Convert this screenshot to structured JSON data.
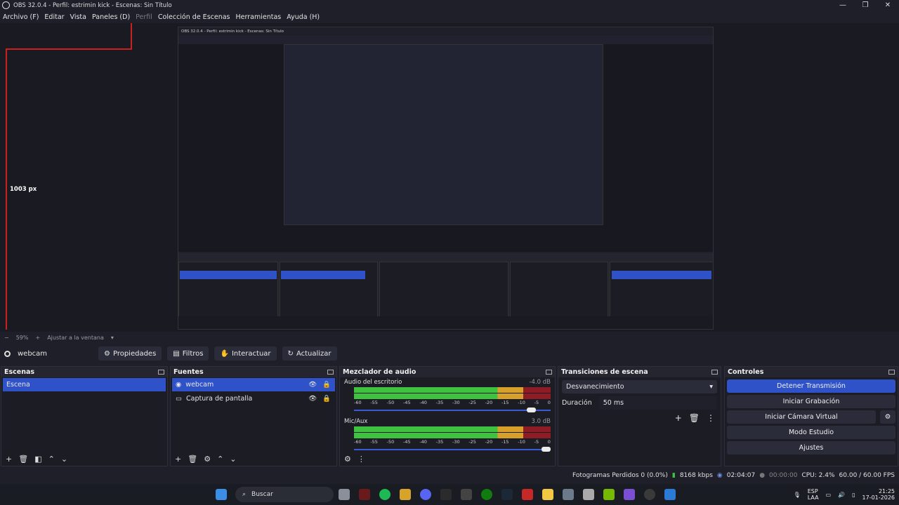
{
  "window": {
    "title": "OBS 32.0.4 - Perfil: estrimin kick - Escenas: Sin Título",
    "controls": [
      "—",
      "❐",
      "✕"
    ]
  },
  "menu": {
    "items": [
      {
        "label": "Archivo (F)",
        "enabled": true
      },
      {
        "label": "Editar",
        "enabled": true
      },
      {
        "label": "Vista",
        "enabled": true
      },
      {
        "label": "Paneles (D)",
        "enabled": true
      },
      {
        "label": "Perfil",
        "enabled": false
      },
      {
        "label": "Colección de Escenas",
        "enabled": true
      },
      {
        "label": "Herramientas",
        "enabled": true
      },
      {
        "label": "Ayuda (H)",
        "enabled": true
      }
    ]
  },
  "preview": {
    "measure_label": "1003 px",
    "nested_title": "OBS 32.0.4 - Perfil: estrimin kick - Escenas: Sin Título"
  },
  "zoom": {
    "minus": "−",
    "value": "59%",
    "plus": "+",
    "fit_label": "Ajustar a la ventana"
  },
  "source_toolbar": {
    "source_name": "webcam",
    "buttons": {
      "properties": "Propiedades",
      "filters": "Filtros",
      "interact": "Interactuar",
      "refresh": "Actualizar"
    }
  },
  "scenes": {
    "title": "Escenas",
    "items": [
      "Escena"
    ]
  },
  "sources": {
    "title": "Fuentes",
    "items": [
      "webcam",
      "Captura de pantalla"
    ]
  },
  "mixer": {
    "title": "Mezclador de audio",
    "channels": [
      {
        "name": "Audio del escritorio",
        "db": "-4.0 dB",
        "volume": 0.92
      },
      {
        "name": "Mic/Aux",
        "db": "3.0 dB",
        "volume": 1.0
      }
    ],
    "ticks": [
      "-60",
      "-55",
      "-50",
      "-45",
      "-40",
      "-35",
      "-30",
      "-25",
      "-20",
      "-15",
      "-10",
      "-5",
      "0"
    ]
  },
  "transitions": {
    "title": "Transiciones de escena",
    "selected": "Desvanecimiento",
    "duration_label": "Duración",
    "duration_value": "50 ms"
  },
  "controls": {
    "title": "Controles",
    "stop_stream": "Detener Transmisión",
    "start_recording": "Iniciar Grabación",
    "virtual_cam": "Iniciar Cámara Virtual",
    "studio_mode": "Modo Estudio",
    "settings": "Ajustes"
  },
  "status": {
    "dropped": "Fotogramas Perdidos 0 (0.0%)",
    "bitrate": "8168 kbps",
    "stream_time": "02:04:07",
    "rec_time": "00:00:00",
    "cpu": "CPU: 2.4%",
    "fps": "60.00 / 60.00 FPS"
  },
  "taskbar": {
    "search": "Buscar",
    "lang": "ESP",
    "lang2": "LAA",
    "time": "21:25",
    "date": "17-01-2026"
  },
  "colors": {
    "accent": "#2f52c9",
    "meter_green": "#3fc23f",
    "meter_yellow": "#d6a02a",
    "meter_red": "#8e1c25"
  }
}
